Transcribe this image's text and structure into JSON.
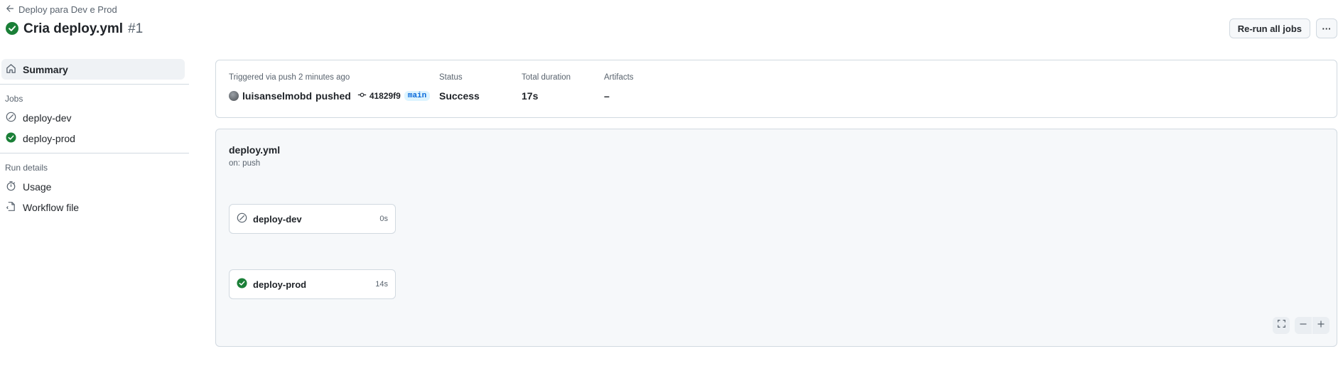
{
  "header": {
    "back_label": "Deploy para Dev e Prod",
    "title": "Cria deploy.yml",
    "run_number": "#1",
    "rerun_label": "Re-run all jobs",
    "more_label": "···"
  },
  "sidebar": {
    "summary_label": "Summary",
    "jobs_heading": "Jobs",
    "jobs": [
      {
        "label": "deploy-dev",
        "status": "skipped"
      },
      {
        "label": "deploy-prod",
        "status": "success"
      }
    ],
    "run_details_heading": "Run details",
    "usage_label": "Usage",
    "workflow_file_label": "Workflow file"
  },
  "summary": {
    "trigger_label": "Triggered via push 2 minutes ago",
    "user": "luisanselmobd",
    "action": "pushed",
    "commit": "41829f9",
    "branch": "main",
    "status_label": "Status",
    "status_value": "Success",
    "duration_label": "Total duration",
    "duration_value": "17s",
    "artifacts_label": "Artifacts",
    "artifacts_value": "–"
  },
  "workflow": {
    "name": "deploy.yml",
    "trigger": "on: push",
    "jobs": [
      {
        "label": "deploy-dev",
        "duration": "0s",
        "status": "skipped"
      },
      {
        "label": "deploy-prod",
        "duration": "14s",
        "status": "success"
      }
    ]
  },
  "colors": {
    "success": "#1a7f37",
    "muted": "#59636e",
    "accent": "#0969da"
  }
}
